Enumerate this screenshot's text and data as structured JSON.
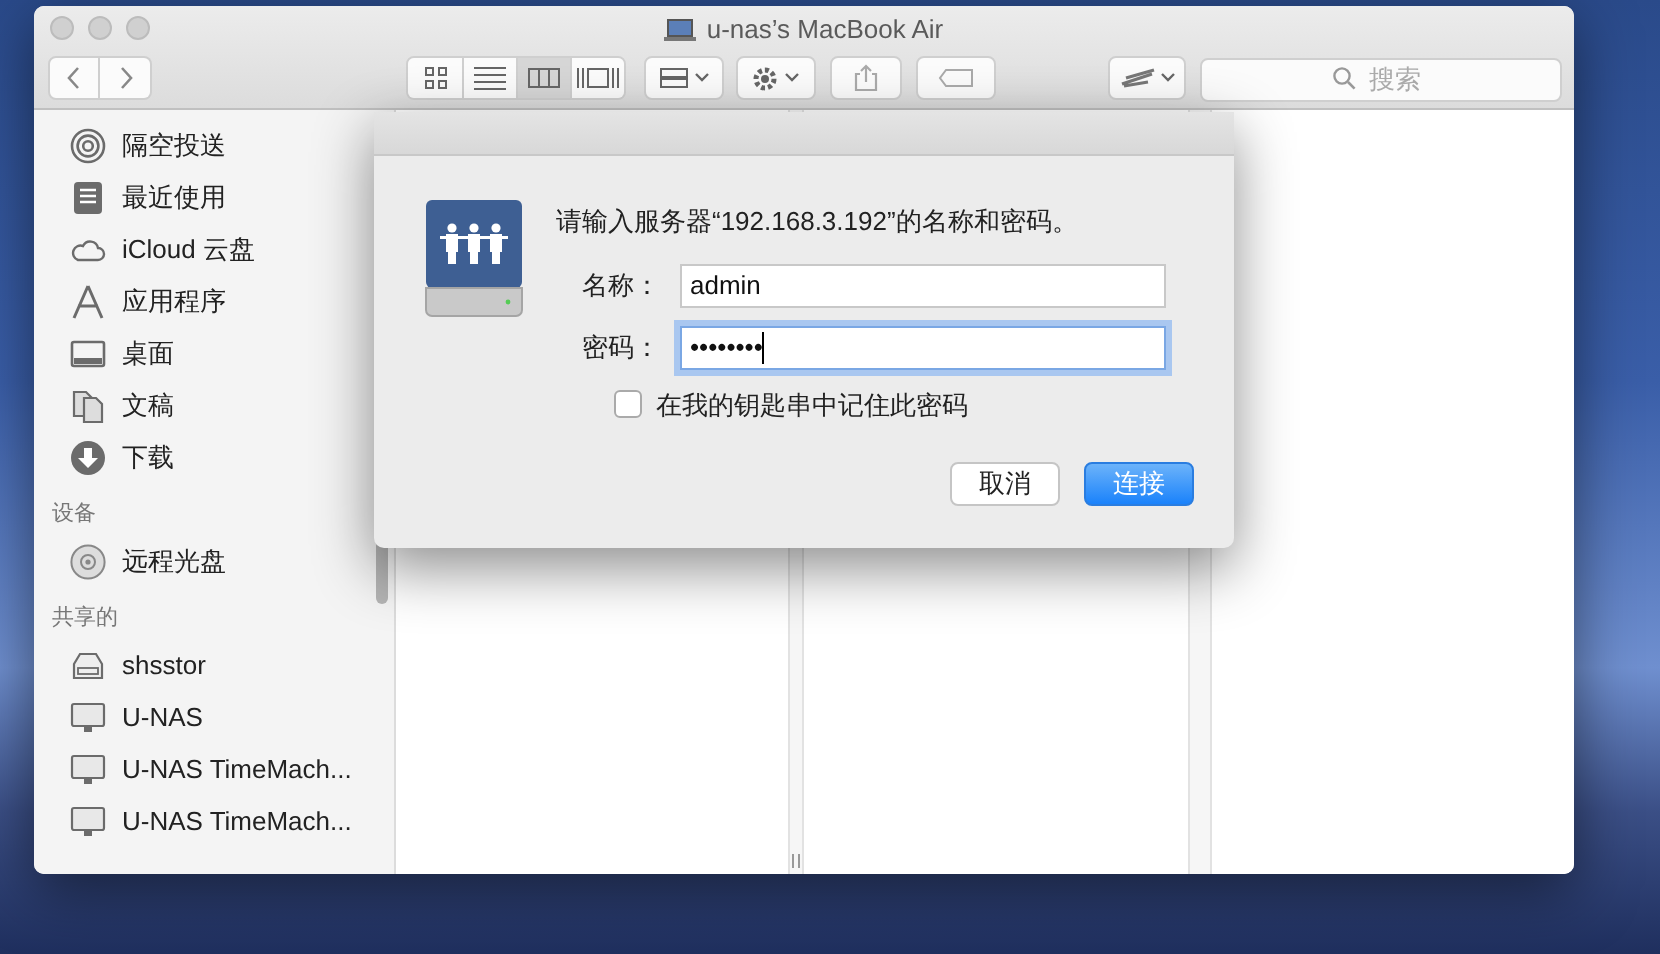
{
  "window": {
    "title": "u-nas’s MacBook Air"
  },
  "toolbar": {
    "view_modes": [
      {
        "kind": "icons",
        "selected": false
      },
      {
        "kind": "list",
        "selected": false
      },
      {
        "kind": "columns",
        "selected": true
      },
      {
        "kind": "gallery",
        "selected": false
      }
    ],
    "search": {
      "placeholder": "搜索"
    }
  },
  "sidebar": {
    "sections": [
      {
        "items": [
          {
            "label": "隔空投送",
            "kind": "airdrop"
          },
          {
            "label": "最近使用",
            "kind": "recents"
          },
          {
            "label": "iCloud 云盘",
            "kind": "cloud"
          },
          {
            "label": "应用程序",
            "kind": "apps"
          },
          {
            "label": "桌面",
            "kind": "desktop"
          },
          {
            "label": "文稿",
            "kind": "documents"
          },
          {
            "label": "下载",
            "kind": "downloads"
          }
        ]
      },
      {
        "heading": "设备",
        "items": [
          {
            "label": "远程光盘",
            "kind": "disc"
          }
        ]
      },
      {
        "heading": "共享的",
        "items": [
          {
            "label": "shsstor",
            "kind": "server"
          },
          {
            "label": "U-NAS",
            "kind": "monitor"
          },
          {
            "label": "U-NAS TimeMach...",
            "kind": "monitor"
          },
          {
            "label": "U-NAS TimeMach...",
            "kind": "monitor"
          }
        ]
      }
    ]
  },
  "dialog": {
    "message": "请输入服务器“192.168.3.192”的名称和密码。",
    "fields": [
      {
        "label": "名称：",
        "value": "admin",
        "focused": false
      },
      {
        "label": "密码：",
        "value": "••••••••",
        "focused": true
      }
    ],
    "remember": {
      "label": "在我的钥匙串中记住此密码",
      "checked": false
    },
    "buttons": [
      {
        "label": "取消",
        "default": false
      },
      {
        "label": "连接",
        "default": true
      }
    ]
  }
}
